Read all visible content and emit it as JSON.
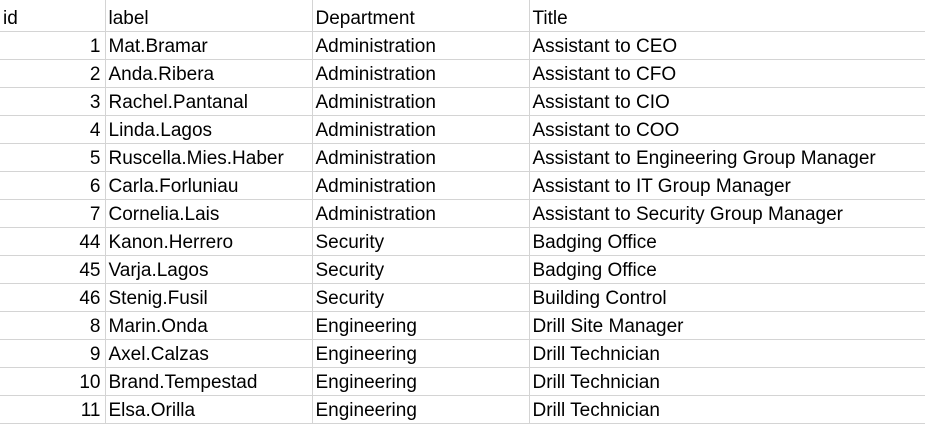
{
  "sheet": {
    "headers": [
      "id",
      "label",
      "Department",
      "Title"
    ],
    "rows": [
      [
        "1",
        "Mat.Bramar",
        "Administration",
        "Assistant to CEO"
      ],
      [
        "2",
        "Anda.Ribera",
        "Administration",
        "Assistant to CFO"
      ],
      [
        "3",
        "Rachel.Pantanal",
        "Administration",
        "Assistant to CIO"
      ],
      [
        "4",
        "Linda.Lagos",
        "Administration",
        "Assistant to COO"
      ],
      [
        "5",
        "Ruscella.Mies.Haber",
        "Administration",
        "Assistant to Engineering Group Manager"
      ],
      [
        "6",
        "Carla.Forluniau",
        "Administration",
        "Assistant to IT Group Manager"
      ],
      [
        "7",
        "Cornelia.Lais",
        "Administration",
        "Assistant to Security Group Manager"
      ],
      [
        "44",
        "Kanon.Herrero",
        "Security",
        "Badging Office"
      ],
      [
        "45",
        "Varja.Lagos",
        "Security",
        "Badging Office"
      ],
      [
        "46",
        "Stenig.Fusil",
        "Security",
        "Building Control"
      ],
      [
        "8",
        "Marin.Onda",
        "Engineering",
        "Drill Site Manager"
      ],
      [
        "9",
        "Axel.Calzas",
        "Engineering",
        "Drill Technician"
      ],
      [
        "10",
        "Brand.Tempestad",
        "Engineering",
        "Drill Technician"
      ],
      [
        "11",
        "Elsa.Orilla",
        "Engineering",
        "Drill Technician"
      ]
    ]
  }
}
